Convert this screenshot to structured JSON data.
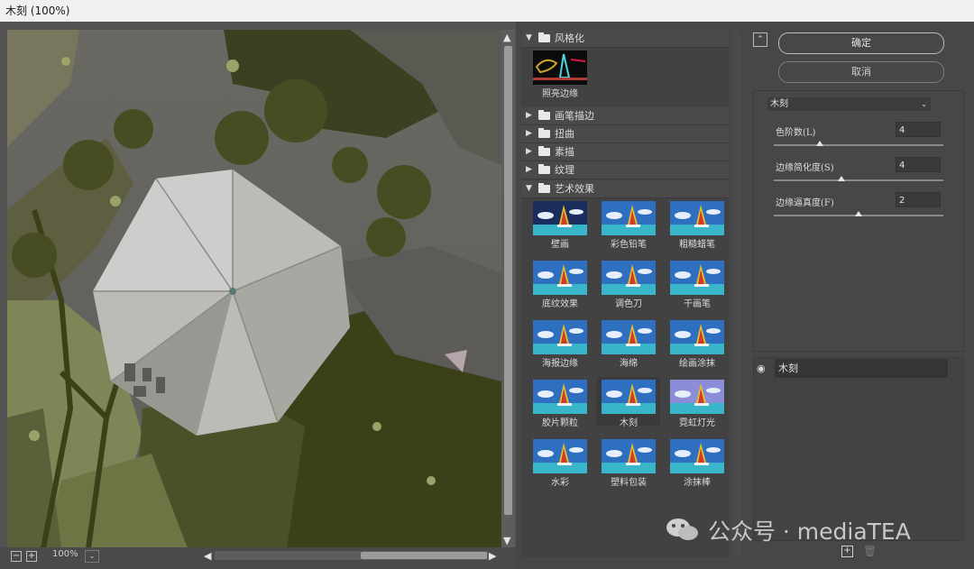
{
  "window": {
    "title": "木刻 (100%)"
  },
  "preview": {
    "zoom": "100%"
  },
  "gallery": {
    "categories": [
      {
        "label": "风格化",
        "expanded": true
      },
      {
        "label": "画笔描边",
        "expanded": false
      },
      {
        "label": "扭曲",
        "expanded": false
      },
      {
        "label": "素描",
        "expanded": false
      },
      {
        "label": "纹理",
        "expanded": false
      },
      {
        "label": "艺术效果",
        "expanded": true
      }
    ],
    "stylize_items": [
      "照亮边缘"
    ],
    "artistic_items": [
      "壁画",
      "彩色铅笔",
      "粗糙蜡笔",
      "底纹效果",
      "调色刀",
      "干画笔",
      "海报边缘",
      "海绵",
      "绘画涂抹",
      "胶片颗粒",
      "木刻",
      "霓虹灯光",
      "水彩",
      "塑料包装",
      "涂抹棒"
    ],
    "selected": "木刻"
  },
  "buttons": {
    "ok": "确定",
    "cancel": "取消"
  },
  "filter": {
    "selected": "木刻",
    "params": [
      {
        "label": "色阶数(L)",
        "value": "4",
        "level": 0.27
      },
      {
        "label": "边缘简化度(S)",
        "value": "4",
        "level": 0.4
      },
      {
        "label": "边缘逼真度(F)",
        "value": "2",
        "level": 0.5
      }
    ]
  },
  "layers": {
    "items": [
      "木刻"
    ]
  },
  "watermark": "公众号 · mediaTEA"
}
